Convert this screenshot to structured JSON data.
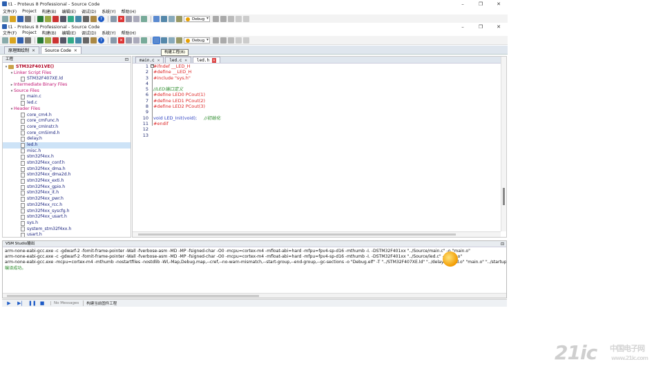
{
  "window_back": {
    "title": "t1 - Proteus 8 Professional - Source Code"
  },
  "window": {
    "title": "t1 - Proteus 8 Professional - Source Code"
  },
  "menu": [
    "文件(F)",
    "Project",
    "构建(B)",
    "编辑(E)",
    "调试(D)",
    "系统(Y)",
    "帮助(H)"
  ],
  "toolbar": {
    "config_value": "Debug",
    "tooltip": "构建工程(B)"
  },
  "doc_tabs": [
    {
      "label": "原理图绘制",
      "close": "✕"
    },
    {
      "label": "Source Code",
      "close": "✕"
    }
  ],
  "editor_tabs": [
    {
      "label": "main.c",
      "close": "✕"
    },
    {
      "label": "led.c",
      "close": "✕"
    },
    {
      "label": "led.h",
      "close": "✕"
    }
  ],
  "project": {
    "panel_title": "工程",
    "pin": "⊡",
    "root": "STM32F401VE()",
    "nodes": [
      {
        "label": "Linker Script Files",
        "kind": "group",
        "level": 1,
        "expanded": true
      },
      {
        "label": "STM32F407XE.ld",
        "kind": "file",
        "level": 2
      },
      {
        "label": "Intermediate Binary Files",
        "kind": "group",
        "level": 1,
        "expanded": false
      },
      {
        "label": "Source Files",
        "kind": "group",
        "level": 1,
        "expanded": true
      },
      {
        "label": "main.c",
        "kind": "file",
        "level": 2
      },
      {
        "label": "led.c",
        "kind": "file",
        "level": 2
      },
      {
        "label": "Header Files",
        "kind": "group",
        "level": 1,
        "expanded": true
      },
      {
        "label": "core_cm4.h",
        "kind": "file",
        "level": 2
      },
      {
        "label": "core_cmFunc.h",
        "kind": "file",
        "level": 2
      },
      {
        "label": "core_cmInstr.h",
        "kind": "file",
        "level": 2
      },
      {
        "label": "core_cmSimd.h",
        "kind": "file",
        "level": 2
      },
      {
        "label": "delay.h",
        "kind": "file",
        "level": 2
      },
      {
        "label": "led.h",
        "kind": "file",
        "level": 2,
        "selected": true
      },
      {
        "label": "misc.h",
        "kind": "file",
        "level": 2
      },
      {
        "label": "stm32f4xx.h",
        "kind": "file",
        "level": 2
      },
      {
        "label": "stm32f4xx_conf.h",
        "kind": "file",
        "level": 2
      },
      {
        "label": "stm32f4xx_dma.h",
        "kind": "file",
        "level": 2
      },
      {
        "label": "stm32f4xx_dma2d.h",
        "kind": "file",
        "level": 2
      },
      {
        "label": "stm32f4xx_exti.h",
        "kind": "file",
        "level": 2
      },
      {
        "label": "stm32f4xx_gpio.h",
        "kind": "file",
        "level": 2
      },
      {
        "label": "stm32f4xx_it.h",
        "kind": "file",
        "level": 2
      },
      {
        "label": "stm32f4xx_pwr.h",
        "kind": "file",
        "level": 2
      },
      {
        "label": "stm32f4xx_rcc.h",
        "kind": "file",
        "level": 2
      },
      {
        "label": "stm32f4xx_syscfg.h",
        "kind": "file",
        "level": 2
      },
      {
        "label": "stm32f4xx_usart.h",
        "kind": "file",
        "level": 2
      },
      {
        "label": "sys.h",
        "kind": "file",
        "level": 2
      },
      {
        "label": "system_stm32f4xx.h",
        "kind": "file",
        "level": 2
      },
      {
        "label": "usart.h",
        "kind": "file",
        "level": 2
      }
    ]
  },
  "editor": {
    "lines": [
      {
        "n": "1",
        "text": "#ifndef __LED_H",
        "color": "red"
      },
      {
        "n": "2",
        "text": "#define __LED_H",
        "color": "red"
      },
      {
        "n": "3",
        "text": "#include \"sys.h\"",
        "color": "red"
      },
      {
        "n": "4",
        "text": "",
        "color": "red"
      },
      {
        "n": "5",
        "text": "//LED端口定义",
        "color": "green"
      },
      {
        "n": "6",
        "text": "#define LED0 PCout(1)",
        "color": "red"
      },
      {
        "n": "7",
        "text": "#define LED1 PCout(2)",
        "color": "red"
      },
      {
        "n": "8",
        "text": "#define LED2 PCout(3)",
        "color": "red"
      },
      {
        "n": "9",
        "text": "",
        "color": "red"
      },
      {
        "n": "10",
        "text": "void LED_Init(void);",
        "comment": "     //初始化",
        "color": "blue"
      },
      {
        "n": "11",
        "text": "#endif",
        "color": "red"
      },
      {
        "n": "12",
        "text": "",
        "color": "red"
      },
      {
        "n": "13",
        "text": "",
        "color": "red"
      }
    ]
  },
  "output": {
    "title": "VSM Studio输出",
    "pin": "⊡",
    "lines": [
      "arm-none-eabi-gcc.exe -c -gdwarf-2 -fomit-frame-pointer -Wall -fverbose-asm -MD -MP -fsigned-char -O0 -mcpu=cortex-m4 -mfloat-abi=hard -mfpu=fpv4-sp-d16 -mthumb -I. -DSTM32F401xx    \"../Source/main.c\" -o \"main.o\"",
      "arm-none-eabi-gcc.exe -c -gdwarf-2 -fomit-frame-pointer -Wall -fverbose-asm -MD -MP -fsigned-char -O0 -mcpu=cortex-m4 -mfloat-abi=hard -mfpu=fpv4-sp-d16 -mthumb -I. -DSTM32F401xx    \"../Source/led.c\" -o \"led.o\"",
      "arm-none-eabi-gcc.exe -mcpu=cortex-m4 -mthumb -nostartfiles -nostdlib  -Wl,-Map,Debug.map,--cref,--no-warn-mismatch,--start-group,--end-group,--gc-sections -o \"Debug.elf\"  -T \"../STM32F407XE.ld\" \"../delay.o\" \"led.o\" \"main.o\" \"../startup_stm32f4xx"
    ],
    "success": "编译成功。"
  },
  "status": {
    "messages": "No Messages",
    "task": "构建当前固件工程"
  },
  "watermark": {
    "brand": "21ic",
    "cn": "中国电子网",
    "url": "www.21ic.com"
  }
}
